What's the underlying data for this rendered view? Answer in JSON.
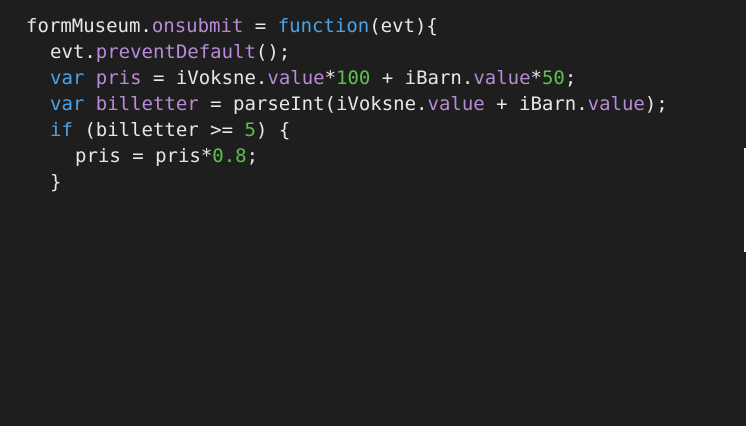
{
  "colors": {
    "background": "#1e1e1e",
    "plain": "#e6e6e6",
    "property": "#b98bd6",
    "keyword": "#4aa3e8",
    "number": "#5fbf4f"
  },
  "code": {
    "line1": {
      "t1": "formMuseum.",
      "t2": "onsubmit",
      "t3": " = ",
      "t4": "function",
      "t5": "(evt){"
    },
    "line2": {
      "t1": "evt.",
      "t2": "preventDefault",
      "t3": "();"
    },
    "line3": {
      "t1": "var",
      "t2": " pris",
      "t3": " = iVoksne.",
      "t4": "value",
      "t5": "*",
      "t6": "100",
      "t7": " + iBarn.",
      "t8": "value",
      "t9": "*",
      "t10": "50",
      "t11": ";"
    },
    "line4": {
      "t1": "var",
      "t2": " billetter",
      "t3": " = parseInt(iVoksne.",
      "t4": "value",
      "t5": " + iBarn.",
      "t6": "value",
      "t7": ");"
    },
    "line5": {
      "t1": "if",
      "t2": " (billetter >= ",
      "t3": "5",
      "t4": ") {"
    },
    "line6": {
      "t1": "pris = pris*",
      "t2": "0.8",
      "t3": ";"
    },
    "line7": {
      "t1": "}"
    }
  }
}
